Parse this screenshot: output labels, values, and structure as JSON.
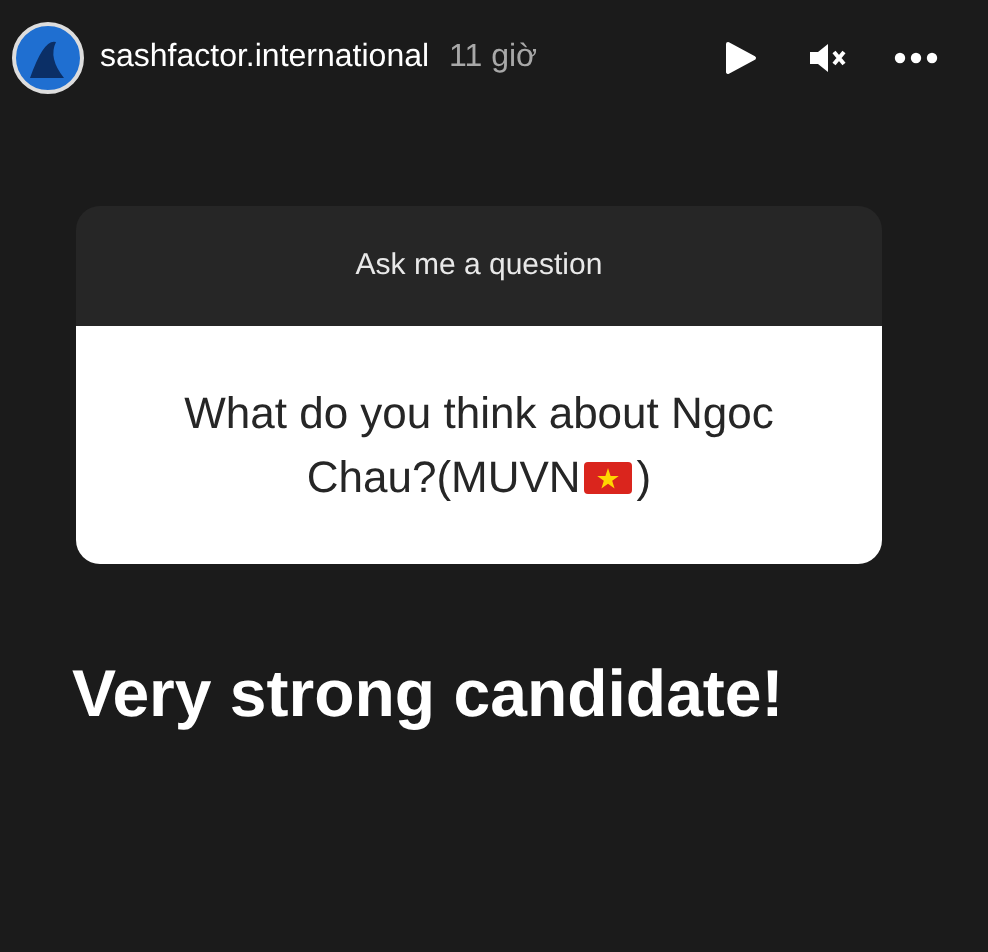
{
  "header": {
    "username": "sashfactor.international",
    "time": "11 giờ"
  },
  "question_card": {
    "title": "Ask me a question",
    "question_lines": [
      "What do you think about Ngoc",
      "Chau?(MUVN"
    ],
    "question_end": ")"
  },
  "answer": "Very strong candidate!"
}
